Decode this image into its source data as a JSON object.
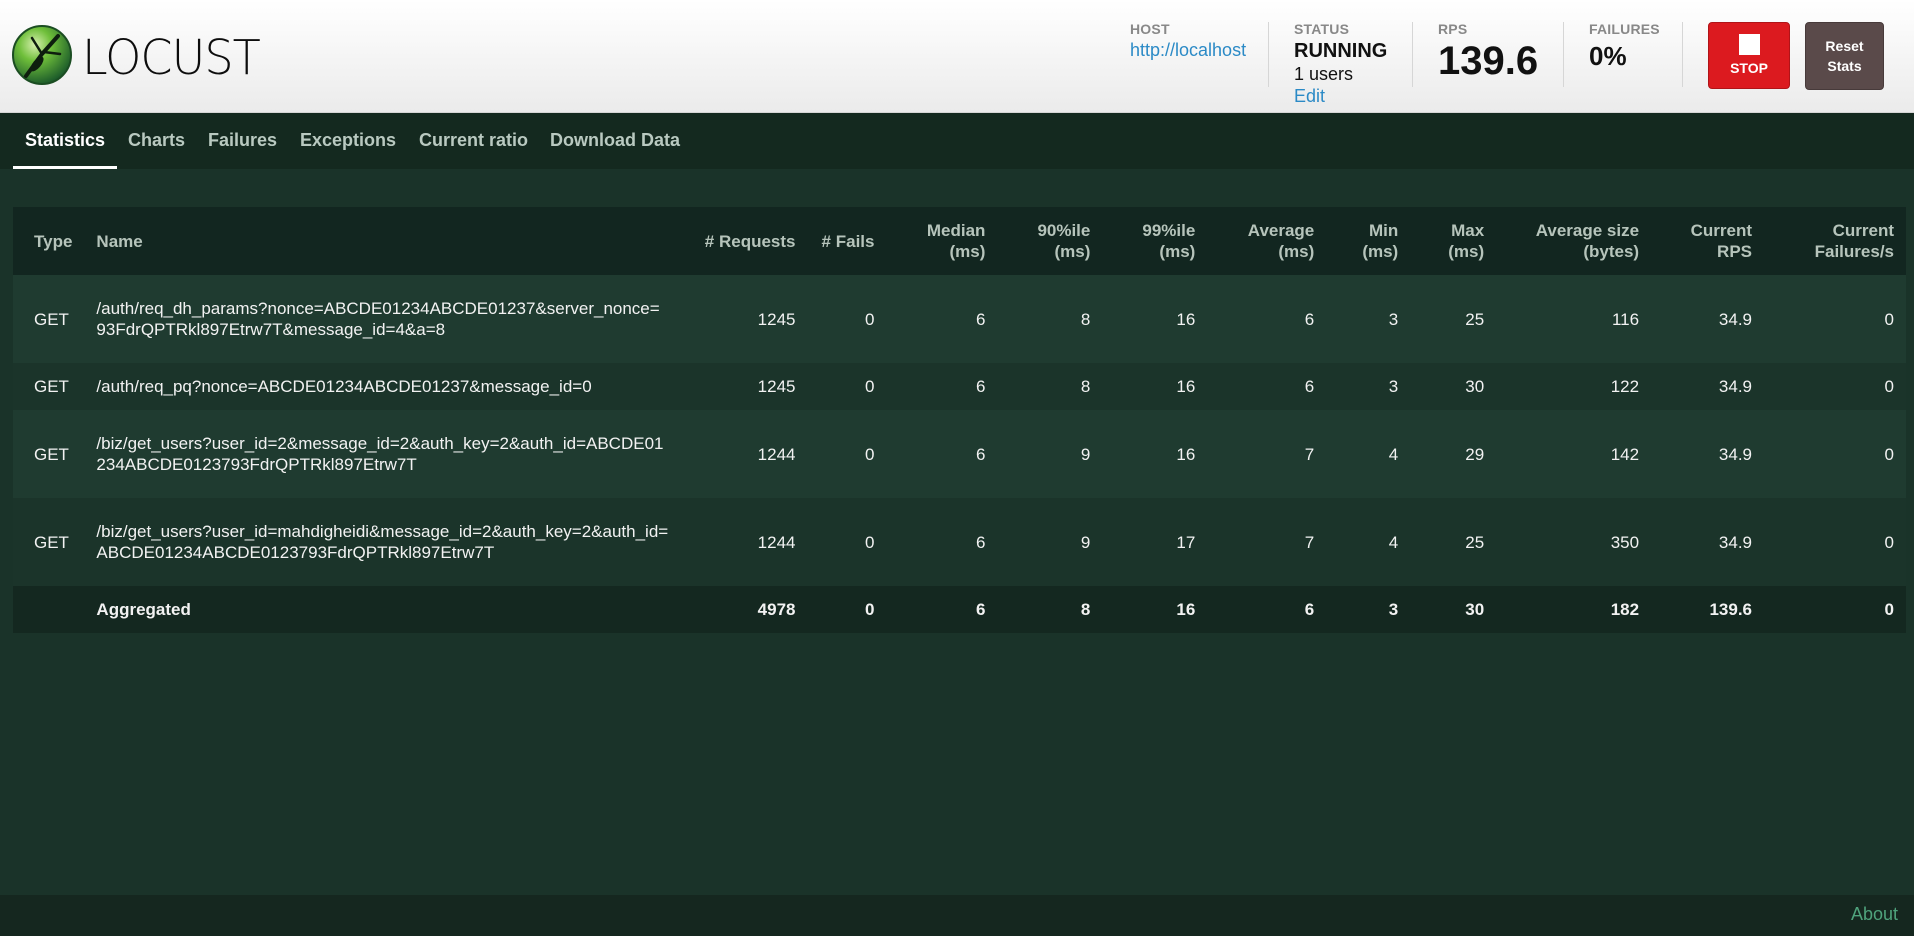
{
  "app": {
    "logo_text": "LOCUST"
  },
  "header": {
    "host_label": "HOST",
    "host_value": "http://localhost",
    "status_label": "STATUS",
    "status_value": "RUNNING",
    "users": "1 users",
    "edit_label": "Edit",
    "rps_label": "RPS",
    "rps_value": "139.6",
    "failures_label": "FAILURES",
    "failures_value": "0%",
    "stop_label": "STOP",
    "reset_label_line1": "Reset",
    "reset_label_line2": "Stats"
  },
  "tabs": [
    {
      "label": "Statistics",
      "active": true
    },
    {
      "label": "Charts"
    },
    {
      "label": "Failures"
    },
    {
      "label": "Exceptions"
    },
    {
      "label": "Current ratio"
    },
    {
      "label": "Download Data"
    }
  ],
  "table": {
    "columns": [
      "Type",
      "Name",
      "# Requests",
      "# Fails",
      "Median (ms)",
      "90%ile (ms)",
      "99%ile (ms)",
      "Average (ms)",
      "Min (ms)",
      "Max (ms)",
      "Average size (bytes)",
      "Current RPS",
      "Current Failures/s"
    ],
    "rows": [
      {
        "type": "GET",
        "name": "/auth/req_dh_params?nonce=ABCDE01234ABCDE01237&server_nonce=93FdrQPTRkl897Etrw7T&message_id=4&a=8",
        "requests": "1245",
        "fails": "0",
        "median": "6",
        "p90": "8",
        "p99": "16",
        "avg": "6",
        "min": "3",
        "max": "25",
        "avg_size": "116",
        "rps": "34.9",
        "fails_s": "0"
      },
      {
        "type": "GET",
        "name": "/auth/req_pq?nonce=ABCDE01234ABCDE01237&message_id=0",
        "requests": "1245",
        "fails": "0",
        "median": "6",
        "p90": "8",
        "p99": "16",
        "avg": "6",
        "min": "3",
        "max": "30",
        "avg_size": "122",
        "rps": "34.9",
        "fails_s": "0"
      },
      {
        "type": "GET",
        "name": "/biz/get_users?user_id=2&message_id=2&auth_key=2&auth_id=ABCDE01234ABCDE0123793FdrQPTRkl897Etrw7T",
        "requests": "1244",
        "fails": "0",
        "median": "6",
        "p90": "9",
        "p99": "16",
        "avg": "7",
        "min": "4",
        "max": "29",
        "avg_size": "142",
        "rps": "34.9",
        "fails_s": "0"
      },
      {
        "type": "GET",
        "name": "/biz/get_users?user_id=mahdigheidi&message_id=2&auth_key=2&auth_id=ABCDE01234ABCDE0123793FdrQPTRkl897Etrw7T",
        "requests": "1244",
        "fails": "0",
        "median": "6",
        "p90": "9",
        "p99": "17",
        "avg": "7",
        "min": "4",
        "max": "25",
        "avg_size": "350",
        "rps": "34.9",
        "fails_s": "0"
      }
    ],
    "aggregated": {
      "type": "",
      "name": "Aggregated",
      "requests": "4978",
      "fails": "0",
      "median": "6",
      "p90": "8",
      "p99": "16",
      "avg": "6",
      "min": "3",
      "max": "30",
      "avg_size": "182",
      "rps": "139.6",
      "fails_s": "0"
    }
  },
  "footer": {
    "about_label": "About"
  }
}
